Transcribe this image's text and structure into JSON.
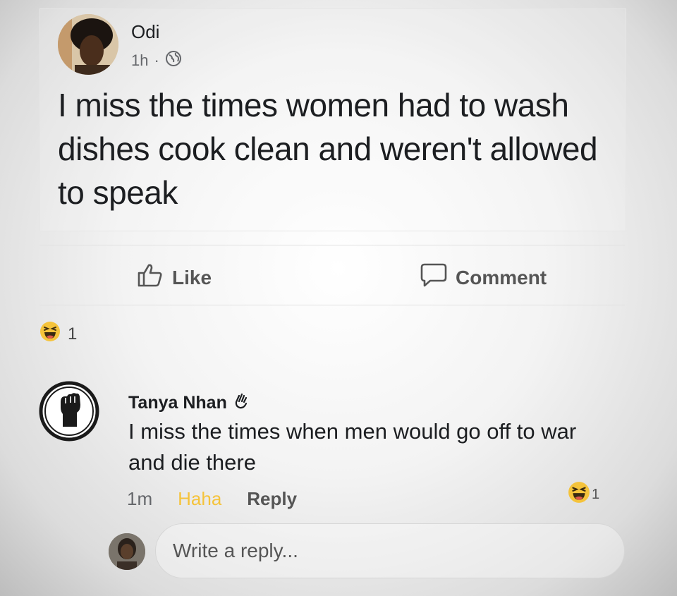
{
  "post": {
    "author": "Odi",
    "time": "1h",
    "separator": "·",
    "audience_icon": "globe-icon",
    "text": "I miss the times women had to wash dishes cook clean and weren't allowed to speak"
  },
  "actions": {
    "like_label": "Like",
    "comment_label": "Comment"
  },
  "reactions": {
    "icon": "haha-emoji-icon",
    "count": "1"
  },
  "comment": {
    "author": "Tanya Nhan",
    "author_badge_icon": "waving-hand-icon",
    "text": "I miss the times when men would go off to war and die there",
    "time": "1m",
    "reaction_label": "Haha",
    "reply_label": "Reply",
    "reaction_icon": "haha-emoji-icon",
    "reaction_count": "1"
  },
  "reply_box": {
    "placeholder": "Write a reply..."
  },
  "colors": {
    "haha_yellow": "#f5c33b",
    "text_primary": "#1c1e21",
    "text_secondary": "#65676b"
  }
}
